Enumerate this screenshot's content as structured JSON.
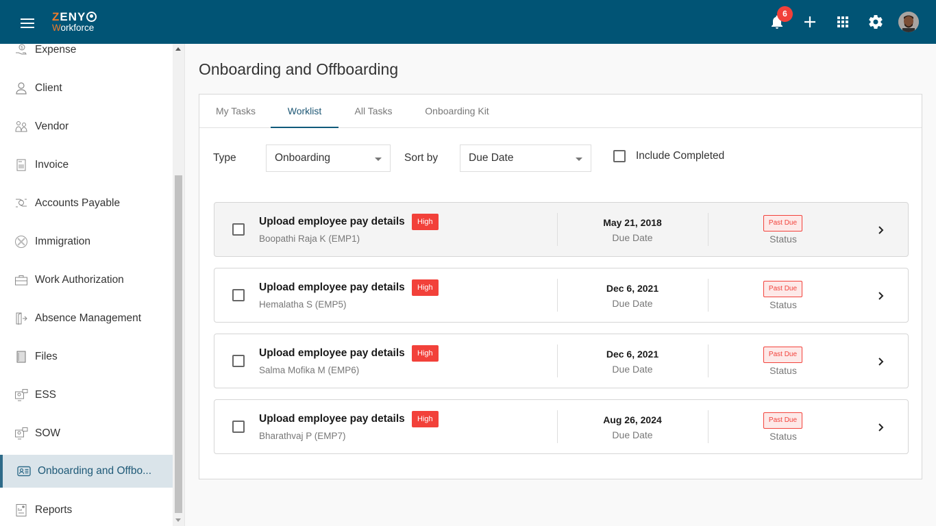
{
  "header": {
    "logo": {
      "line1_first": "Z",
      "line1_rest": "ENY",
      "line2_first": "W",
      "line2_rest": "orkforce"
    },
    "notification_count": "6",
    "icons": [
      "menu-icon",
      "bell-icon",
      "plus-icon",
      "apps-grid-icon",
      "gear-icon",
      "avatar"
    ]
  },
  "sidebar": {
    "items": [
      {
        "label": "Expense",
        "icon": "expense-icon"
      },
      {
        "label": "Client",
        "icon": "user-icon"
      },
      {
        "label": "Vendor",
        "icon": "vendor-icon"
      },
      {
        "label": "Invoice",
        "icon": "invoice-icon"
      },
      {
        "label": "Accounts Payable",
        "icon": "accounts-payable-icon"
      },
      {
        "label": "Immigration",
        "icon": "immigration-icon"
      },
      {
        "label": "Work Authorization",
        "icon": "briefcase-icon"
      },
      {
        "label": "Absence Management",
        "icon": "exit-door-icon"
      },
      {
        "label": "Files",
        "icon": "files-icon"
      },
      {
        "label": "ESS",
        "icon": "ess-icon"
      },
      {
        "label": "SOW",
        "icon": "sow-icon"
      },
      {
        "label": "Onboarding and Offbo...",
        "icon": "id-card-icon",
        "active": true
      },
      {
        "label": "Reports",
        "icon": "reports-icon"
      }
    ]
  },
  "main": {
    "title": "Onboarding and Offboarding",
    "tabs": [
      {
        "label": "My Tasks"
      },
      {
        "label": "Worklist",
        "active": true
      },
      {
        "label": "All Tasks"
      },
      {
        "label": "Onboarding Kit"
      }
    ],
    "filters": {
      "type_label": "Type",
      "type_value": "Onboarding",
      "sort_label": "Sort by",
      "sort_value": "Due Date",
      "include_completed_label": "Include Completed",
      "include_completed_checked": false
    },
    "tasks": [
      {
        "title": "Upload employee pay details",
        "priority": "High",
        "employee": "Boopathi Raja K (EMP1)",
        "due_date": "May 21, 2018",
        "due_label": "Due Date",
        "status": "Past Due",
        "status_label": "Status"
      },
      {
        "title": "Upload employee pay details",
        "priority": "High",
        "employee": "Hemalatha S (EMP5)",
        "due_date": "Dec 6, 2021",
        "due_label": "Due Date",
        "status": "Past Due",
        "status_label": "Status"
      },
      {
        "title": "Upload employee pay details",
        "priority": "High",
        "employee": "Salma Mofika M (EMP6)",
        "due_date": "Dec 6, 2021",
        "due_label": "Due Date",
        "status": "Past Due",
        "status_label": "Status"
      },
      {
        "title": "Upload employee pay details",
        "priority": "High",
        "employee": "Bharathvaj P (EMP7)",
        "due_date": "Aug 26, 2024",
        "due_label": "Due Date",
        "status": "Past Due",
        "status_label": "Status"
      }
    ]
  },
  "colors": {
    "header_bg": "#015475",
    "logo_accent": "#f07b2a",
    "badge_red": "#f1403a",
    "priority_red": "#f2413a",
    "active_tab": "#0f5a7a",
    "sidebar_active_bg": "#dae4ea"
  }
}
